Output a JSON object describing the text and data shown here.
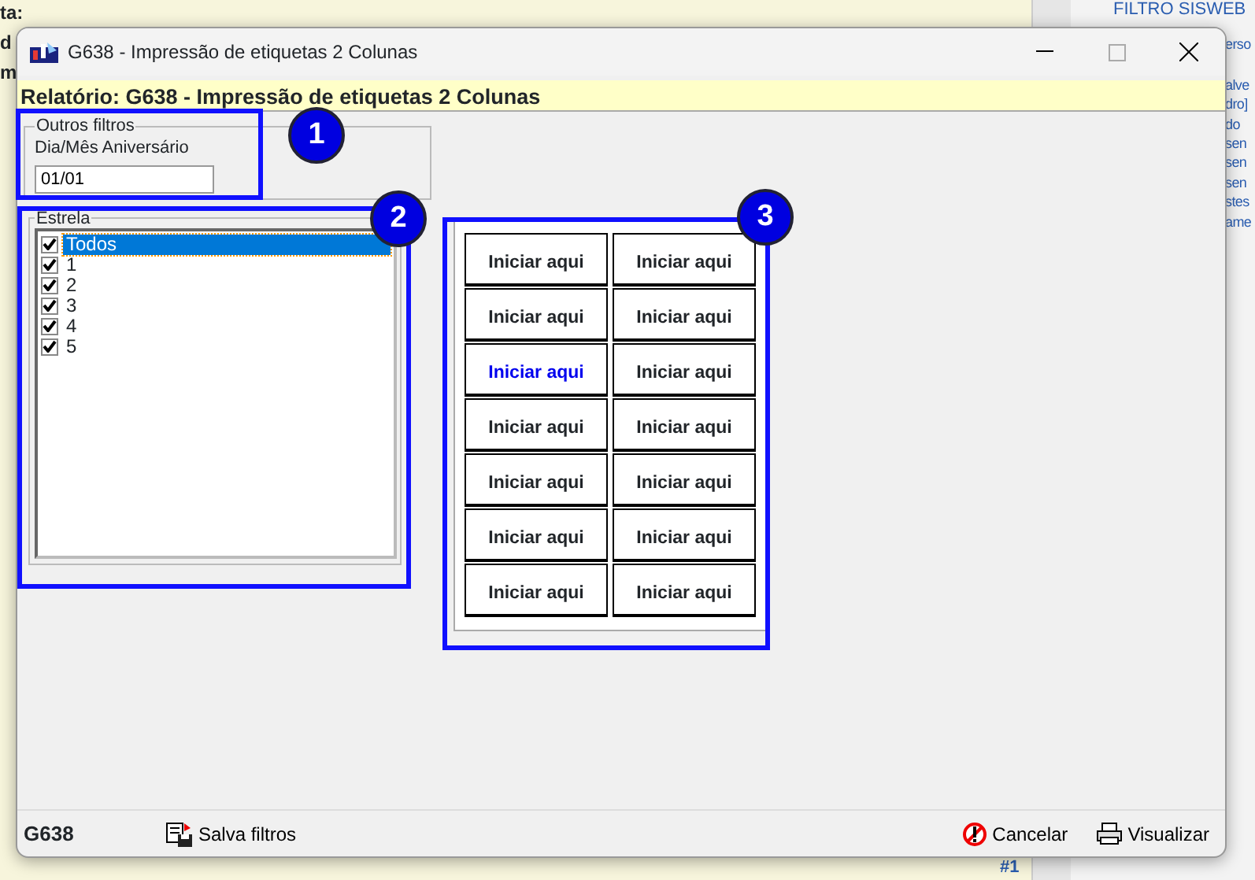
{
  "background": {
    "left_texts": [
      "ta:",
      "d",
      "m"
    ],
    "right_title": "FILTRO SISWEB",
    "right_texts": [
      "erso",
      "alve",
      "dro]",
      "do",
      "sen",
      "sen",
      "sen",
      "stes",
      "ame"
    ],
    "bottom_text": "#1"
  },
  "window": {
    "title": "G638 - Impressão de etiquetas 2 Colunas"
  },
  "report_bar": "Relatório: G638 - Impressão de etiquetas 2 Colunas",
  "other_filters": {
    "legend": "Outros filtros",
    "label": "Dia/Mês Aniversário",
    "value": "01/01"
  },
  "stars": {
    "legend": "Estrela",
    "items": [
      {
        "label": "Todos",
        "checked": true,
        "selected": true
      },
      {
        "label": "1",
        "checked": true,
        "selected": false
      },
      {
        "label": "2",
        "checked": true,
        "selected": false
      },
      {
        "label": "3",
        "checked": true,
        "selected": false
      },
      {
        "label": "4",
        "checked": true,
        "selected": false
      },
      {
        "label": "5",
        "checked": true,
        "selected": false
      }
    ]
  },
  "labels_grid": [
    {
      "text": "Iniciar aqui",
      "selected": false
    },
    {
      "text": "Iniciar aqui",
      "selected": false
    },
    {
      "text": "Iniciar aqui",
      "selected": false
    },
    {
      "text": "Iniciar aqui",
      "selected": false
    },
    {
      "text": "Iniciar aqui",
      "selected": true
    },
    {
      "text": "Iniciar aqui",
      "selected": false
    },
    {
      "text": "Iniciar aqui",
      "selected": false
    },
    {
      "text": "Iniciar aqui",
      "selected": false
    },
    {
      "text": "Iniciar aqui",
      "selected": false
    },
    {
      "text": "Iniciar aqui",
      "selected": false
    },
    {
      "text": "Iniciar aqui",
      "selected": false
    },
    {
      "text": "Iniciar aqui",
      "selected": false
    },
    {
      "text": "Iniciar aqui",
      "selected": false
    },
    {
      "text": "Iniciar aqui",
      "selected": false
    }
  ],
  "annotations": [
    "1",
    "2",
    "3"
  ],
  "footer": {
    "code": "G638",
    "save": "Salva filtros",
    "cancel": "Cancelar",
    "preview": "Visualizar"
  }
}
